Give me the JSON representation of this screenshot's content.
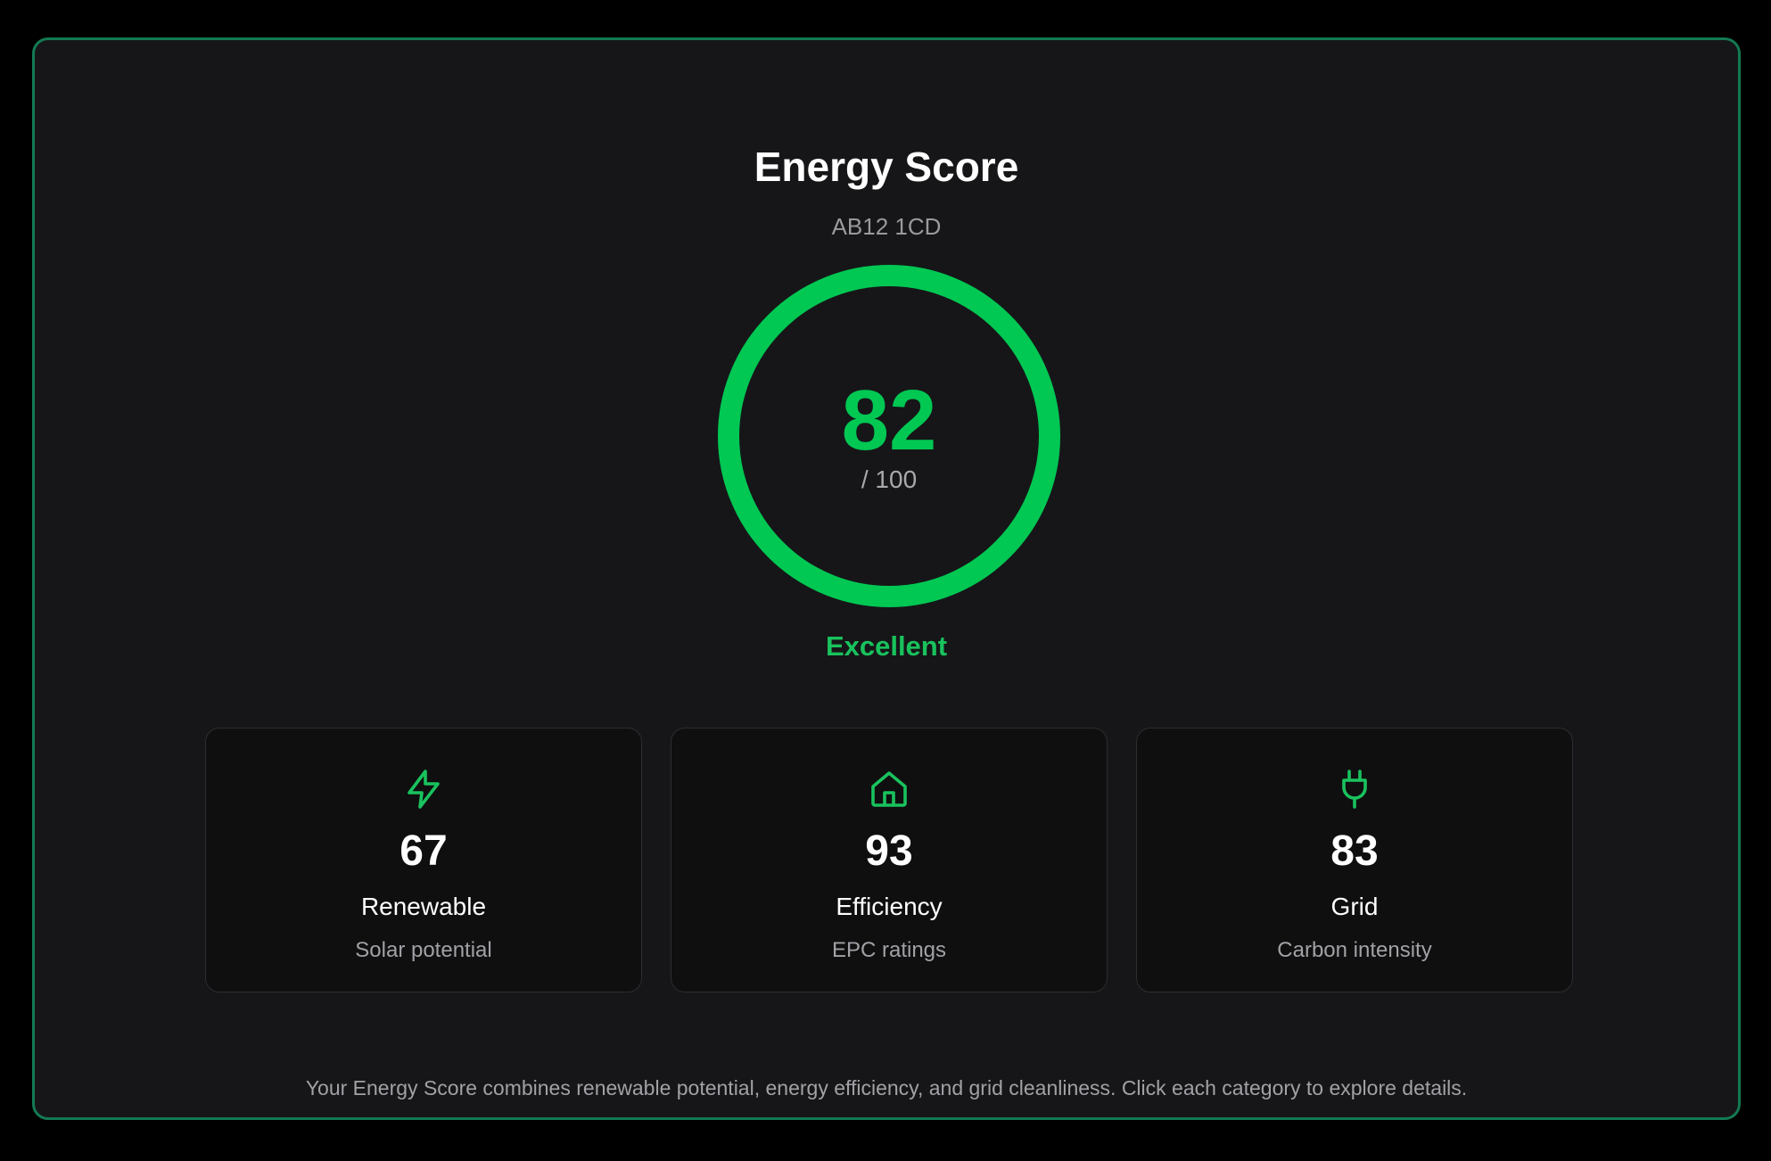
{
  "header": {
    "title": "Energy Score",
    "postcode": "AB12 1CD"
  },
  "score": {
    "value": "82",
    "max_label": "/ 100",
    "fraction": 0.82,
    "rating": "Excellent",
    "accent_color": "#00c853"
  },
  "categories": [
    {
      "icon": "lightning-icon",
      "value": "67",
      "label": "Renewable",
      "description": "Solar potential"
    },
    {
      "icon": "home-icon",
      "value": "93",
      "label": "Efficiency",
      "description": "EPC ratings"
    },
    {
      "icon": "plug-icon",
      "value": "83",
      "label": "Grid",
      "description": "Carbon intensity"
    }
  ],
  "footer": {
    "text": "Your Energy Score combines renewable potential, energy efficiency, and grid cleanliness. Click each category to explore details."
  },
  "colors": {
    "border": "#137a52",
    "background": "#161618",
    "card_background": "#0f0f10",
    "icon": "#19c25d"
  }
}
